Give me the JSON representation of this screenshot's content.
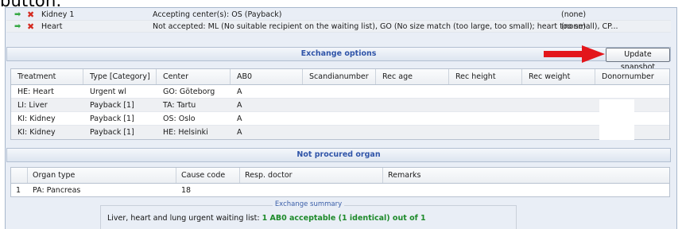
{
  "caption": "button.",
  "offers": [
    {
      "organ": "Kidney 1",
      "status": "Accepting center(s): OS (Payback)",
      "info": "(none)"
    },
    {
      "organ": "Heart",
      "status": "Not accepted: ML (No suitable recipient on the waiting list), GO (No size match (too large, too small); heart too small), CP...",
      "info": "(none)"
    }
  ],
  "exchange_options": {
    "title": "Exchange options",
    "snapshot_button": "Update snapshot",
    "columns": [
      "Treatment",
      "Type [Category]",
      "Center",
      "AB0",
      "Scandianumber",
      "Rec age",
      "Rec height",
      "Rec weight",
      "Donornumber"
    ],
    "rows": [
      [
        "HE: Heart",
        "Urgent wl",
        "GO: Göteborg",
        "A",
        "",
        "",
        "",
        "",
        ""
      ],
      [
        "LI: Liver",
        "Payback [1]",
        "TA: Tartu",
        "A",
        "",
        "",
        "",
        "",
        ""
      ],
      [
        "KI: Kidney",
        "Payback [1]",
        "OS: Oslo",
        "A",
        "",
        "",
        "",
        "",
        ""
      ],
      [
        "KI: Kidney",
        "Payback [1]",
        "HE: Helsinki",
        "A",
        "",
        "",
        "",
        "",
        ""
      ]
    ]
  },
  "not_procured": {
    "title": "Not procured organ",
    "columns": [
      "Organ type",
      "Cause code",
      "Resp. doctor",
      "Remarks"
    ],
    "rows": [
      {
        "num": "1",
        "cells": [
          "PA: Pancreas",
          "18",
          "",
          ""
        ]
      }
    ]
  },
  "summary": {
    "legend": "Exchange summary",
    "label": "Liver, heart and lung urgent waiting list:",
    "value": "1 AB0 acceptable (1 identical) out of 1"
  },
  "colors": {
    "accept_arrow": "#36a844",
    "reject_x": "#d42a1f",
    "section_title": "#2f54a8",
    "summary_value": "#1d8a2a"
  }
}
